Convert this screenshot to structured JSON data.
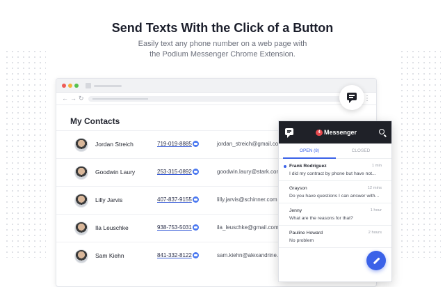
{
  "header": {
    "title": "Send Texts With the Click of a Button",
    "subtitle_line1": "Easily text any phone number on a web page with",
    "subtitle_line2": "the Podium Messenger Chrome Extension."
  },
  "browser": {
    "nav_back": "←",
    "nav_forward": "→",
    "nav_reload": "↻",
    "menu": "⋮"
  },
  "contacts": {
    "title": "My Contacts",
    "rows": [
      {
        "name": "Jordan Streich",
        "phone": "719-019-8885",
        "email": "jordan_streich@gmail.com"
      },
      {
        "name": "Goodwin Laury",
        "phone": "253-315-0892",
        "email": "goodwin.laury@stark.com"
      },
      {
        "name": "Lilly Jarvis",
        "phone": "407-837-9155",
        "email": "lilly.jarvis@schinner.com"
      },
      {
        "name": "Ila Leuschke",
        "phone": "938-753-5031",
        "email": "ila_leuschke@gmail.com"
      },
      {
        "name": "Sam Kiehn",
        "phone": "841-332-8122",
        "email": "sam.kiehn@alexandrine.com"
      }
    ]
  },
  "messenger": {
    "badge": "4",
    "title": "Messenger",
    "tab_open": "OPEN (8)",
    "tab_closed": "CLOSED",
    "conversations": [
      {
        "name": "Frank Rodriguez",
        "time": "1 min",
        "preview": "I did my contract by phone but have not...",
        "unread": true
      },
      {
        "name": "Grayson",
        "time": "12 mins",
        "preview": "Do you have questions I can answer with...",
        "unread": false
      },
      {
        "name": "Jenny",
        "time": "1 hour",
        "preview": "What are the reasons for that?",
        "unread": false
      },
      {
        "name": "Pauline Howard",
        "time": "2 hours",
        "preview": "No problem",
        "unread": false
      }
    ]
  },
  "colors": {
    "accent": "#3b62e8",
    "header_dark": "#1f2128",
    "badge_red": "#e5484d"
  },
  "icons": {
    "messenger_launcher": "chat-bubble-icon",
    "search": "search-icon",
    "compose": "pencil-icon",
    "phone_link": "chat-icon"
  }
}
